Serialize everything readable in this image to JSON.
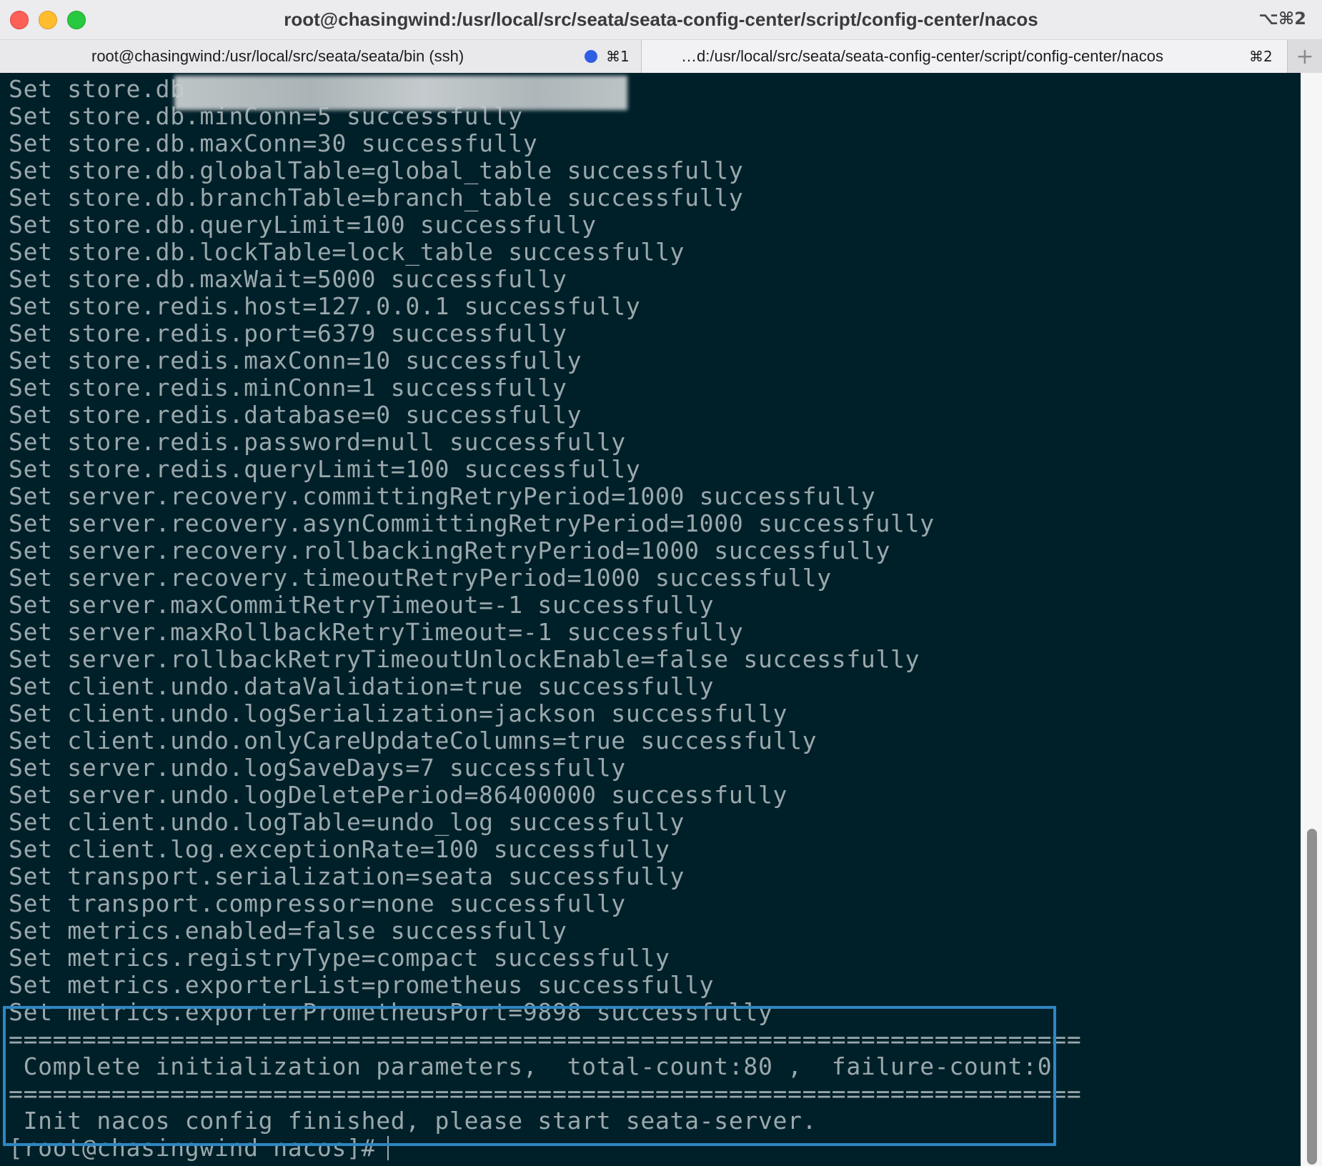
{
  "window": {
    "title": "root@chasingwind:/usr/local/src/seata/seata-config-center/script/config-center/nacos",
    "shortcut": "⌥⌘2"
  },
  "tabs": [
    {
      "label": "root@chasingwind:/usr/local/src/seata/seata/bin (ssh)",
      "shortcut": "⌘1",
      "has_activity_dot": true
    },
    {
      "label": "…d:/usr/local/src/seata/seata-config-center/script/config-center/nacos (ssh)",
      "shortcut": "⌘2",
      "active": true
    }
  ],
  "new_tab": "+",
  "terminal": {
    "lines": [
      "Set store.db",
      "Set store.db.minConn=5 successfully",
      "Set store.db.maxConn=30 successfully",
      "Set store.db.globalTable=global_table successfully",
      "Set store.db.branchTable=branch_table successfully",
      "Set store.db.queryLimit=100 successfully",
      "Set store.db.lockTable=lock_table successfully",
      "Set store.db.maxWait=5000 successfully",
      "Set store.redis.host=127.0.0.1 successfully",
      "Set store.redis.port=6379 successfully",
      "Set store.redis.maxConn=10 successfully",
      "Set store.redis.minConn=1 successfully",
      "Set store.redis.database=0 successfully",
      "Set store.redis.password=null successfully",
      "Set store.redis.queryLimit=100 successfully",
      "Set server.recovery.committingRetryPeriod=1000 successfully",
      "Set server.recovery.asynCommittingRetryPeriod=1000 successfully",
      "Set server.recovery.rollbackingRetryPeriod=1000 successfully",
      "Set server.recovery.timeoutRetryPeriod=1000 successfully",
      "Set server.maxCommitRetryTimeout=-1 successfully",
      "Set server.maxRollbackRetryTimeout=-1 successfully",
      "Set server.rollbackRetryTimeoutUnlockEnable=false successfully",
      "Set client.undo.dataValidation=true successfully",
      "Set client.undo.logSerialization=jackson successfully",
      "Set client.undo.onlyCareUpdateColumns=true successfully",
      "Set server.undo.logSaveDays=7 successfully",
      "Set server.undo.logDeletePeriod=86400000 successfully",
      "Set client.undo.logTable=undo_log successfully",
      "Set client.log.exceptionRate=100 successfully",
      "Set transport.serialization=seata successfully",
      "Set transport.compressor=none successfully",
      "Set metrics.enabled=false successfully",
      "Set metrics.registryType=compact successfully",
      "Set metrics.exporterList=prometheus successfully",
      "Set metrics.exporterPrometheusPort=9898 successfully",
      "=========================================================================",
      " Complete initialization parameters,  total-count:80 ,  failure-count:0",
      "=========================================================================",
      " Init nacos config finished, please start seata-server.",
      "[root@chasingwind nacos]#"
    ]
  },
  "colors": {
    "terminal_bg": "#002029",
    "terminal_fg": "#9aa8ac",
    "highlight_border": "#2f86c3"
  }
}
